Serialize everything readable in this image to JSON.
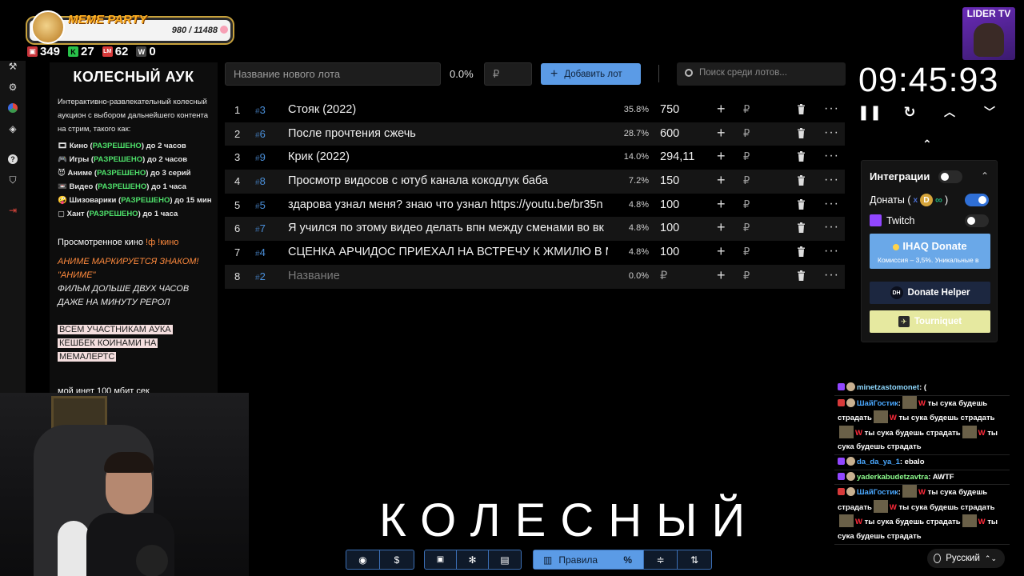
{
  "overlay": {
    "meme_title": "MEME PARTY",
    "meme_count": "980 / 11488",
    "stats": [
      {
        "icon": "twitch-icon",
        "value": "349",
        "color": "#c9343b"
      },
      {
        "icon": "kick-icon",
        "value": "27",
        "color": "#28c24a"
      },
      {
        "icon": "lm-icon",
        "value": "62",
        "color": "#d83a3a"
      },
      {
        "icon": "w-icon",
        "value": "0",
        "color": "#444444"
      }
    ],
    "lider_label": "LIDER TV"
  },
  "left_panel": {
    "title": "КОЛЕСНЫЙ АУК",
    "description": "Интерактивно-развлекательный колесный аукцион с выбором дальнейшего контента на стрим, такого как:",
    "items": [
      {
        "icon": "🎞",
        "label": "Кино",
        "ok": "РАЗРЕШЕНО",
        "rest": "до 2 часов"
      },
      {
        "icon": "🎮",
        "label": "Игры",
        "ok": "РАЗРЕШЕНО",
        "rest": "до 2 часов"
      },
      {
        "icon": "😈",
        "label": "Аниме",
        "ok": "РАЗРЕШЕНО",
        "rest": "до 3 серий"
      },
      {
        "icon": "📼",
        "label": "Видео",
        "ok": "РАЗРЕШЕНО",
        "rest": "до 1 часа"
      },
      {
        "icon": "🤪",
        "label": "Шизоварики",
        "ok": "РАЗРЕШЕНО",
        "rest": "до 15 мин"
      },
      {
        "icon": "▢",
        "label": "Хант",
        "ok": "РАЗРЕШЕНО",
        "rest": "до 1 часа"
      }
    ],
    "watched_prefix": "Просмотренное кино",
    "watched_cmd": "!ф !кино",
    "anime_lines": [
      "АНИМЕ МАРКИРУЕТСЯ ЗНАКОМ!",
      "\"АНИМЕ\"",
      "ФИЛЬМ ДОЛЬШЕ ДВУХ ЧАСОВ",
      "ДАЖЕ НА МИНУТУ РЕРОЛ"
    ],
    "cashback_lines": [
      "ВСЕМ УЧАСТНИКАМ АУКА",
      "КЕШБЕК КОИНАМИ НА",
      "МЕМАЛЕРТС"
    ],
    "inet": "мой инет 100 мбит сек"
  },
  "toolbar": {
    "new_lot_placeholder": "Название нового лота",
    "percent": "0.0%",
    "currency": "₽",
    "add_label": "Добавить лот",
    "search_placeholder": "Поиск среди лотов..."
  },
  "lots": [
    {
      "num": "1",
      "id": "3",
      "name": "Стояк (2022)",
      "pct": "35.8%",
      "amount": "750"
    },
    {
      "num": "2",
      "id": "6",
      "name": "После прочтения сжечь",
      "pct": "28.7%",
      "amount": "600"
    },
    {
      "num": "3",
      "id": "9",
      "name": "Крик (2022)",
      "pct": "14.0%",
      "amount": "294,11"
    },
    {
      "num": "4",
      "id": "8",
      "name": "Просмотр видосов с ютуб канала кокодлук баба",
      "pct": "7.2%",
      "amount": "150"
    },
    {
      "num": "5",
      "id": "5",
      "name": "здарова узнал меня? знаю что узнал https://youtu.be/br35n",
      "pct": "4.8%",
      "amount": "100"
    },
    {
      "num": "6",
      "id": "7",
      "name": "Я учился по этому видео делать впн между сменами во вк",
      "pct": "4.8%",
      "amount": "100"
    },
    {
      "num": "7",
      "id": "4",
      "name": "СЦЕНКА АРЧИДОС ПРИЕХАЛ НА ВСТРЕЧУ К ЖМИЛЮ В М",
      "pct": "4.8%",
      "amount": "100"
    },
    {
      "num": "8",
      "id": "2",
      "name": "Название",
      "pct": "0.0%",
      "amount": "₽"
    }
  ],
  "timer": {
    "value": "09:45:93"
  },
  "integrations": {
    "title": "Интеграции",
    "donations_label": "Донаты (",
    "donations_x": "x",
    "donations_close": ")",
    "twitch_label": "Twitch",
    "ihaq_title": "IHAQ Donate",
    "ihaq_sub": "Комиссия – 3,5%. Уникальные в",
    "donate_helper": "Donate Helper",
    "tourniquet": "Tourniquet"
  },
  "chat": [
    {
      "user": "minetzastomonet",
      "cls": "n-tw",
      "text": " (",
      "emote_spam": false
    },
    {
      "user": "ШайГостик",
      "cls": "n-blue",
      "spam": [
        "ты сука будешь страдать",
        "ты сука будешь страдать",
        "ты сука будешь страдать",
        "ты сука будешь страдать"
      ],
      "emote_spam": true
    },
    {
      "user": "da_da_ya_1",
      "cls": "n-blue",
      "text": " ebalo",
      "emote_spam": false
    },
    {
      "user": "yaderkabudetzavtra",
      "cls": "n-green",
      "text": " AWTF",
      "emote_spam": false
    },
    {
      "user": "ШайГостик",
      "cls": "n-blue",
      "spam": [
        "ты сука будешь страдать",
        "ты сука будешь страдать",
        "ты сука будешь страдать",
        "ты сука будешь страдать"
      ],
      "emote_spam": true
    }
  ],
  "big_word": "КОЛЕСНЫЙ",
  "bottom": {
    "rules_label": "Правила",
    "language": "Русский"
  }
}
